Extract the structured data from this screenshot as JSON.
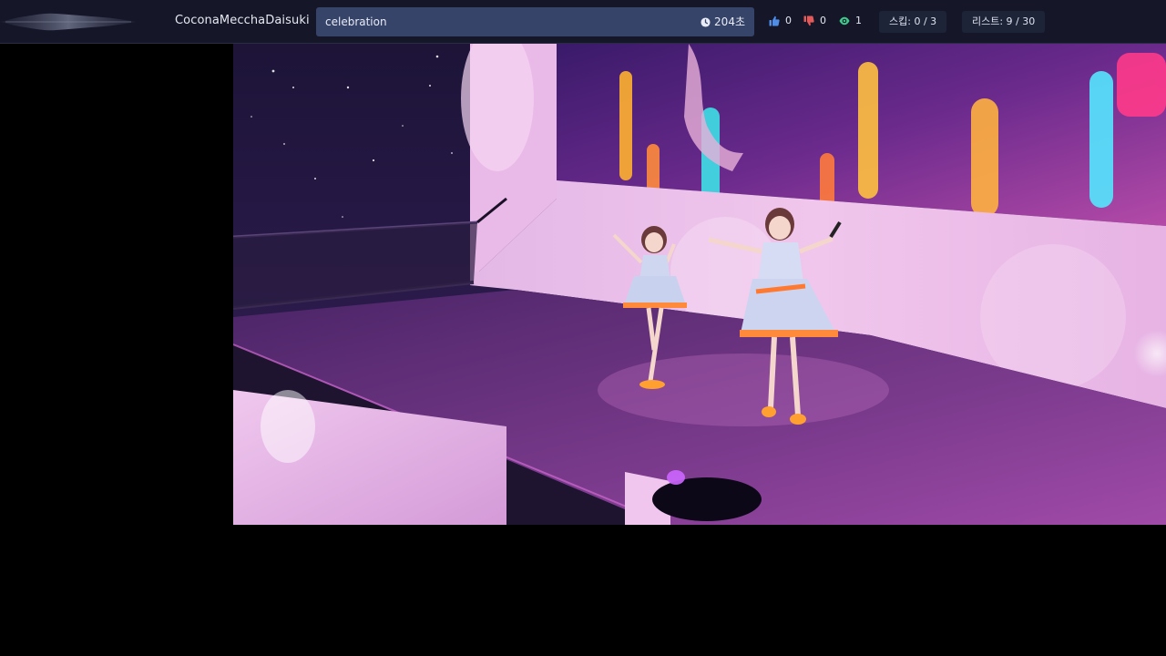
{
  "header": {
    "username": "CoconaMecchaDaisuki",
    "song_title": "celebration",
    "timer": "204초",
    "likes": "0",
    "dislikes": "0",
    "views": "1",
    "skip_label": "스킵: 0 / 3",
    "list_label": "리스트: 9 / 30"
  },
  "icons": {
    "logo": "waveform-logo",
    "timer": "clock-icon",
    "likes": "thumbs-up-icon",
    "dislikes": "thumbs-down-icon",
    "views": "eye-icon"
  },
  "colors": {
    "topbar_bg": "#151628",
    "title_box_bg": "#36446a",
    "like": "#4f8de6",
    "dislike": "#e35a5a",
    "view": "#3fc98c"
  }
}
